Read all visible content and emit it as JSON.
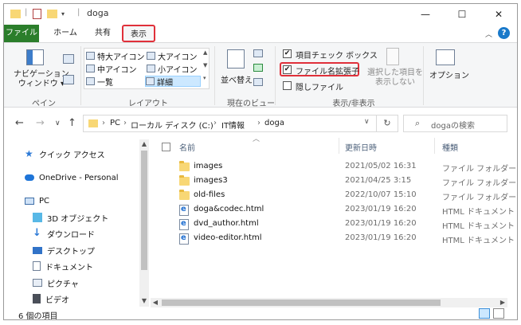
{
  "window": {
    "title": "doga",
    "controls": {
      "minimize": "—",
      "maximize": "☐",
      "close": "✕"
    }
  },
  "ribbon_tabs": [
    "ファイル",
    "ホーム",
    "共有",
    "表示"
  ],
  "ribbon": {
    "pane": {
      "nav_label": "ナビゲーション\nウィンドウ ▾",
      "group": "ペイン"
    },
    "layout": {
      "items": [
        "特大アイコン",
        "大アイコン",
        "中アイコン",
        "小アイコン",
        "一覧",
        "詳細"
      ],
      "selected": "詳細",
      "group": "レイアウト"
    },
    "current_view": {
      "sort_label": "並べ替え",
      "group": "現在のビュー"
    },
    "show_hide": {
      "item_checkbox": {
        "label": "項目チェック ボックス",
        "checked": true
      },
      "file_ext": {
        "label": "ファイル名拡張子",
        "checked": true
      },
      "hidden": {
        "label": "隠しファイル",
        "checked": false
      },
      "hide_selected": "選択した項目を\n表示しない",
      "group": "表示/非表示"
    },
    "options": "オプション"
  },
  "address": {
    "crumbs": [
      "PC",
      "ローカル ディスク (C:)",
      "IT情報",
      "doga"
    ],
    "separator": "›"
  },
  "search": {
    "placeholder": "dogaの検索"
  },
  "nav_pane": [
    {
      "label": "クイック アクセス",
      "icon": "star-icon"
    },
    {
      "label": "OneDrive - Personal",
      "icon": "cloud-icon"
    },
    {
      "label": "PC",
      "icon": "pc-icon"
    },
    {
      "label": "3D オブジェクト",
      "icon": "cube-icon"
    },
    {
      "label": "ダウンロード",
      "icon": "download-icon"
    },
    {
      "label": "デスクトップ",
      "icon": "desktop-icon"
    },
    {
      "label": "ドキュメント",
      "icon": "document-icon"
    },
    {
      "label": "ピクチャ",
      "icon": "picture-icon"
    },
    {
      "label": "ビデオ",
      "icon": "video-icon"
    }
  ],
  "columns": {
    "name": "名前",
    "date": "更新日時",
    "type": "種類"
  },
  "files": [
    {
      "name": "images",
      "date": "2021/05/02 16:31",
      "type": "ファイル フォルダー",
      "kind": "folder"
    },
    {
      "name": "images3",
      "date": "2021/04/25 3:15",
      "type": "ファイル フォルダー",
      "kind": "folder"
    },
    {
      "name": "old-files",
      "date": "2022/10/07 15:10",
      "type": "ファイル フォルダー",
      "kind": "folder"
    },
    {
      "name": "doga&codec.html",
      "date": "2023/01/19 16:20",
      "type": "HTML ドキュメント",
      "kind": "html"
    },
    {
      "name": "dvd_author.html",
      "date": "2023/01/19 16:20",
      "type": "HTML ドキュメント",
      "kind": "html"
    },
    {
      "name": "video-editor.html",
      "date": "2023/01/19 16:20",
      "type": "HTML ドキュメント",
      "kind": "html"
    }
  ],
  "status": {
    "item_count": "6 個の項目"
  },
  "colors": {
    "accent": "#1979ca",
    "highlight": "#e0303a",
    "folder": "#f8d775"
  }
}
